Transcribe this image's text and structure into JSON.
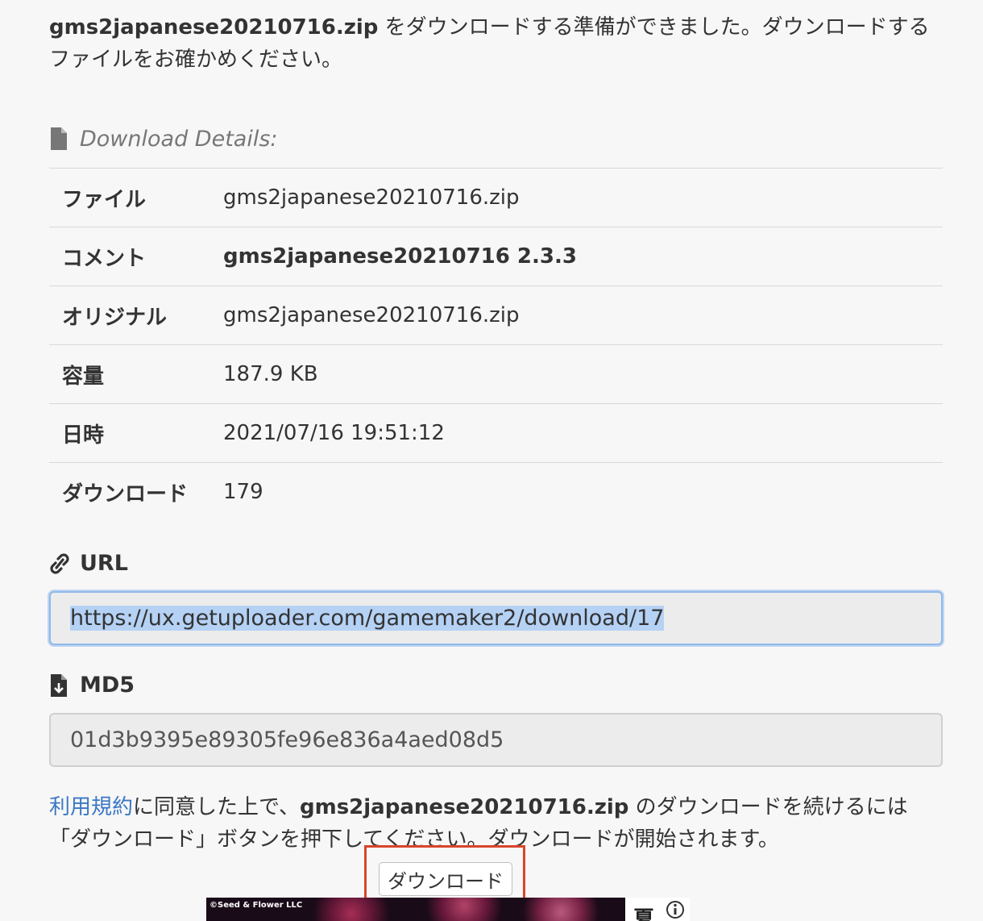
{
  "intro": {
    "filename": "gms2japanese20210716.zip",
    "message": " をダウンロードする準備ができました。ダウンロードするファイルをお確かめください。"
  },
  "details": {
    "heading": "Download Details:",
    "rows": [
      {
        "label": "ファイル",
        "value": "gms2japanese20210716.zip"
      },
      {
        "label": "コメント",
        "value": "gms2japanese20210716 2.3.3"
      },
      {
        "label": "オリジナル",
        "value": "gms2japanese20210716.zip"
      },
      {
        "label": "容量",
        "value": "187.9 KB"
      },
      {
        "label": "日時",
        "value": "2021/07/16 19:51:12"
      },
      {
        "label": "ダウンロード",
        "value": "179"
      }
    ]
  },
  "url": {
    "heading": "URL",
    "value": "https://ux.getuploader.com/gamemaker2/download/17"
  },
  "md5": {
    "heading": "MD5",
    "value": "01d3b9395e89305fe96e836a4aed08d5"
  },
  "consent": {
    "terms_link": "利用規約",
    "text_before_file": "に同意した上で、",
    "filename": "gms2japanese20210716.zip",
    "text_after_file": " のダウンロードを続けるには「ダウンロード」ボタンを押下してください。ダウンロードが開始されます。"
  },
  "download_button": {
    "label": "ダウンロード"
  },
  "ad": {
    "credit": "©Seed & Flower LLC",
    "char": "夏",
    "info_icon": "info-icon"
  },
  "colors": {
    "link": "#3a78c3",
    "highlight_box": "#d9442c",
    "focus_border": "#8fb8ea",
    "selection": "#b5d2f5"
  },
  "icons": {
    "details": "file-icon",
    "url": "link-icon",
    "md5": "file-download-icon"
  }
}
